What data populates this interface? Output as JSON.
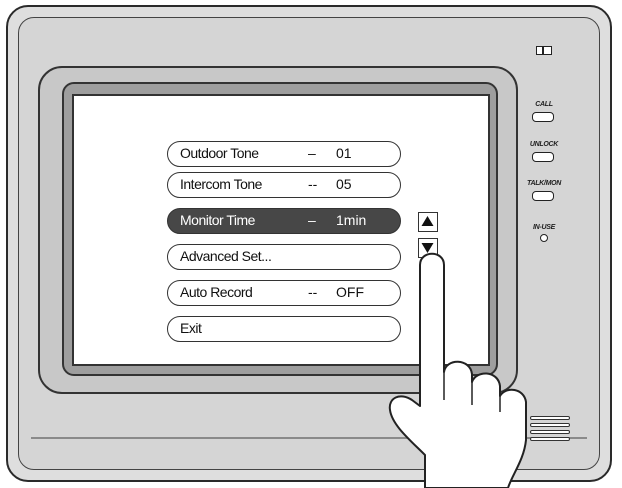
{
  "menu": {
    "items": [
      {
        "label": "Outdoor Tone",
        "dash": "–",
        "value": "01",
        "selected": false
      },
      {
        "label": "Intercom Tone",
        "dash": "--",
        "value": "05",
        "selected": false
      },
      {
        "label": "Monitor Time",
        "dash": "–",
        "value": "1min",
        "selected": true
      },
      {
        "label": "Advanced Set...",
        "dash": "",
        "value": "",
        "selected": false
      },
      {
        "label": "Auto Record",
        "dash": "--",
        "value": "OFF",
        "selected": false
      },
      {
        "label": "Exit",
        "dash": "",
        "value": "",
        "selected": false
      }
    ]
  },
  "scroll": {
    "up_icon": "triangle-up-icon",
    "down_icon": "triangle-down-icon"
  },
  "side_panel": {
    "call_label": "CALL",
    "unlock_label": "UNLOCK",
    "talkmon_label": "TALK/MON",
    "inuse_label": "IN-USE"
  },
  "colors": {
    "selected_bg": "#474747",
    "outline": "#333333",
    "screen_bg": "#ffffff"
  }
}
